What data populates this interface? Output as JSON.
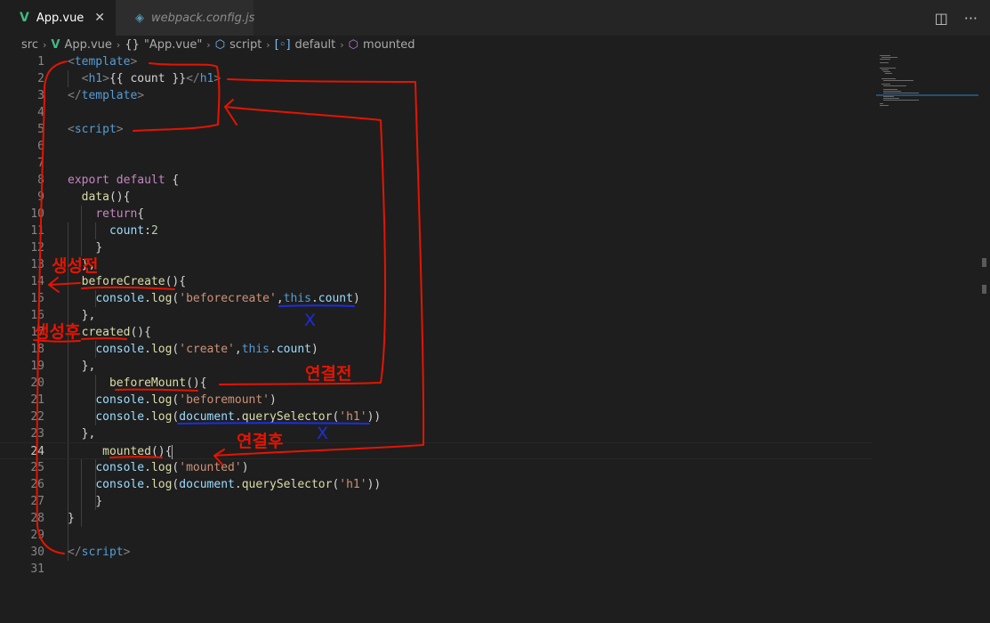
{
  "tabs": [
    {
      "label": "App.vue",
      "icon": "vue-icon",
      "active": true
    },
    {
      "label": "webpack.config.js",
      "icon": "webpack-icon",
      "active": false
    }
  ],
  "tab_actions": {
    "split": "split-editor-icon",
    "more": "more-icon"
  },
  "breadcrumb": {
    "items": [
      "src",
      "App.vue",
      "\"App.vue\"",
      "script",
      "default",
      "mounted"
    ]
  },
  "editor": {
    "current_line": 24,
    "lines": [
      {
        "n": "1"
      },
      {
        "n": "2"
      },
      {
        "n": "3"
      },
      {
        "n": "4"
      },
      {
        "n": "5"
      },
      {
        "n": "6"
      },
      {
        "n": "7"
      },
      {
        "n": "8"
      },
      {
        "n": "9"
      },
      {
        "n": "10"
      },
      {
        "n": "11"
      },
      {
        "n": "12"
      },
      {
        "n": "13"
      },
      {
        "n": "14"
      },
      {
        "n": "15"
      },
      {
        "n": "16"
      },
      {
        "n": "17"
      },
      {
        "n": "18"
      },
      {
        "n": "19"
      },
      {
        "n": "20"
      },
      {
        "n": "21"
      },
      {
        "n": "22"
      },
      {
        "n": "23"
      },
      {
        "n": "24"
      },
      {
        "n": "25"
      },
      {
        "n": "26"
      },
      {
        "n": "27"
      },
      {
        "n": "28"
      },
      {
        "n": "29"
      },
      {
        "n": "30"
      },
      {
        "n": "31"
      }
    ],
    "code": {
      "template": "template",
      "h1": "h1",
      "count_expr": "{{ count }}",
      "script": "script",
      "export": "export",
      "default": "default",
      "data": "data",
      "return": "return",
      "count_key": "count",
      "count_val": "2",
      "beforeCreate": "beforeCreate",
      "console": "console",
      "log": "log",
      "str_beforecreate": "'beforecreate'",
      "this": "this",
      "count": "count",
      "created": "created",
      "str_create": "'create'",
      "beforeMount": "beforeMount",
      "str_beforemount": "'beforemount'",
      "document": "document",
      "querySelector": "querySelector",
      "str_h1": "'h1'",
      "mounted": "mounted",
      "str_mounted": "'mounted'"
    }
  },
  "annotations": {
    "before_create": "생성전",
    "after_create": "생성후",
    "before_connect": "연결전",
    "after_connect": "연결후",
    "cross_1": "X",
    "cross_2": "X"
  },
  "colors": {
    "accent_vue": "#41b883",
    "annotation_red": "#e51400",
    "annotation_blue": "#1a2fe0"
  }
}
